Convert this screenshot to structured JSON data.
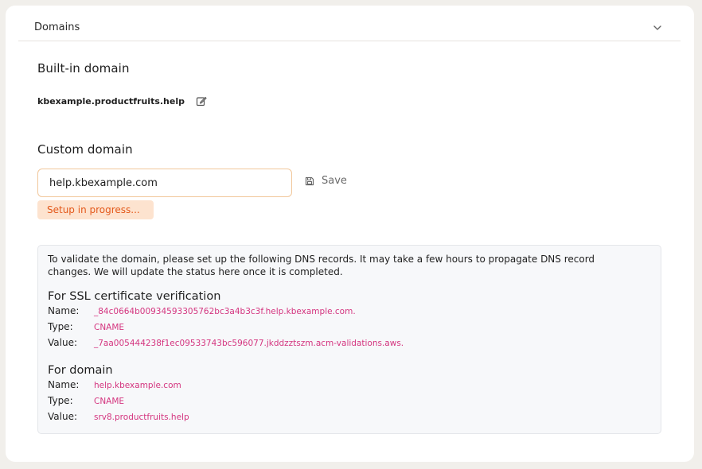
{
  "section": {
    "title": "Domains",
    "toggle_icon": "chevron-down-icon"
  },
  "builtin": {
    "title": "Built-in domain",
    "value": "kbexample.productfruits.help",
    "edit_icon": "edit-icon"
  },
  "custom": {
    "title": "Custom domain",
    "input_value": "help.kbexample.com",
    "save_label": "Save",
    "save_icon": "floppy-disk-icon",
    "status": "Setup in progress..."
  },
  "dns": {
    "intro": "To validate the domain, please set up the following DNS records. It may take a few hours to propagate DNS record changes. We will update the status here once it is completed.",
    "ssl": {
      "title": "For SSL certificate verification",
      "name_label": "Name:",
      "name_value": "_84c0664b00934593305762bc3a4b3c3f.help.kbexample.com.",
      "type_label": "Type:",
      "type_value": "CNAME",
      "value_label": "Value:",
      "value_value": "_7aa005444238f1ec09533743bc596077.jkddzztszm.acm-validations.aws."
    },
    "domain": {
      "title": "For domain",
      "name_label": "Name:",
      "name_value": "help.kbexample.com",
      "type_label": "Type:",
      "type_value": "CNAME",
      "value_label": "Value:",
      "value_value": "srv8.productfruits.help"
    }
  },
  "colors": {
    "page_bg": "#f1efeb",
    "accent_orange": "#e3581a",
    "badge_bg": "#fde3cf",
    "record_pink": "#d4357f",
    "input_border": "#f1c79b"
  }
}
